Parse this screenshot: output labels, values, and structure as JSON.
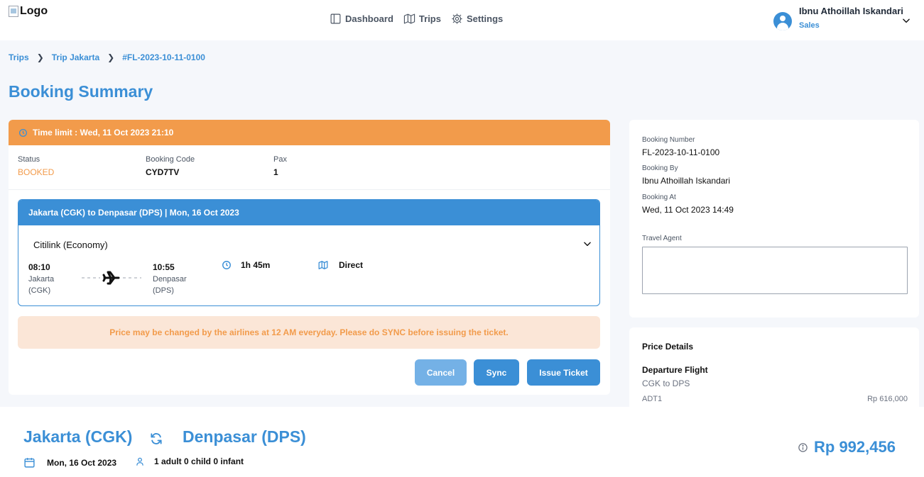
{
  "header": {
    "logo_alt": "Logo",
    "nav": [
      {
        "label": "Dashboard",
        "icon": "dashboard-icon"
      },
      {
        "label": "Trips",
        "icon": "map-icon"
      },
      {
        "label": "Settings",
        "icon": "gear-icon"
      }
    ],
    "user": {
      "name": "Ibnu Athoillah Iskandari",
      "role": "Sales"
    }
  },
  "breadcrumb": [
    "Trips",
    "Trip Jakarta",
    "#FL-2023-10-11-0100"
  ],
  "page_title": "Booking Summary",
  "booking": {
    "time_limit": "Time limit : Wed, 11 Oct 2023 21:10",
    "status_label": "Status",
    "status_value": "BOOKED",
    "code_label": "Booking Code",
    "code_value": "CYD7TV",
    "pax_label": "Pax",
    "pax_value": "1"
  },
  "flight": {
    "heading": "Jakarta (CGK) to Denpasar (DPS) | Mon, 16 Oct 2023",
    "airline": "Citilink (Economy)",
    "depart_time": "08:10",
    "depart_city": "Jakarta",
    "depart_code": "(CGK)",
    "arrive_time": "10:55",
    "arrive_city": "Denpasar",
    "arrive_code": "(DPS)",
    "duration": "1h 45m",
    "stops": "Direct"
  },
  "notice": "Price may be changed by the airlines at 12 AM everyday. Please do SYNC before issuing the ticket.",
  "actions": {
    "cancel": "Cancel",
    "sync": "Sync",
    "issue": "Issue Ticket"
  },
  "summary": {
    "booking_number_label": "Booking Number",
    "booking_number": "FL-2023-10-11-0100",
    "booking_by_label": "Booking By",
    "booking_by": "Ibnu Athoillah Iskandari",
    "booking_at_label": "Booking At",
    "booking_at": "Wed, 11 Oct 2023 14:49",
    "agent_label": "Travel Agent",
    "agent_value": ""
  },
  "price_details": {
    "title": "Price Details",
    "departure_title": "Departure Flight",
    "departure_route": "CGK to DPS",
    "pax_type": "ADT1",
    "pax_price": "Rp 616,000"
  },
  "bottom": {
    "from": "Jakarta (CGK)",
    "to": "Denpasar (DPS)",
    "date": "Mon, 16 Oct 2023",
    "pax": "1 adult 0 child 0 infant",
    "total": "Rp 992,456"
  },
  "colors": {
    "accent": "#3b8fd6",
    "warning": "#f29b4b",
    "warning_bg": "#fbe6d7"
  }
}
